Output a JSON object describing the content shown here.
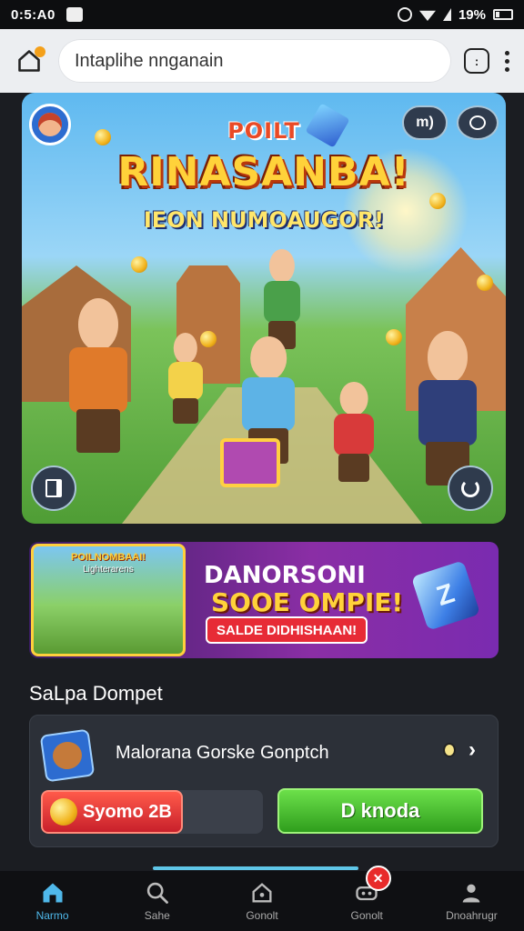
{
  "status": {
    "time": "0:5:A0",
    "battery": "19%"
  },
  "browser": {
    "url": "Intaplihe nnganain"
  },
  "hero": {
    "kicker": "POILT",
    "title": "RINASANBA!",
    "subtitle": "IEON NUMOAUGOR!",
    "chip_label": "m)"
  },
  "promo": {
    "thumb_title": "POILNOMBAAI!",
    "thumb_sub": "Lighterarens",
    "line1": "DANORSONI",
    "line2": "SOOE OMPIE!",
    "badge": "SALDE DIDHISHAAN!",
    "gem_letter": "Z"
  },
  "section": {
    "title": "SaLpa Dompet"
  },
  "card": {
    "title": "Malorana Gorske Gonptch",
    "balance": "Syomo 2B",
    "action": "D knoda"
  },
  "nav": {
    "items": [
      {
        "label": "Narmo",
        "icon": "home-icon"
      },
      {
        "label": "Sahe",
        "icon": "search-icon"
      },
      {
        "label": "Gonolt",
        "icon": "house-icon"
      },
      {
        "label": "Dnoahrugr",
        "icon": "user-icon"
      }
    ],
    "game_icon": "gamepad-icon"
  },
  "colors": {
    "accent": "#4fb8ea",
    "action": "#3fb52a",
    "badge": "#e82a2a"
  }
}
